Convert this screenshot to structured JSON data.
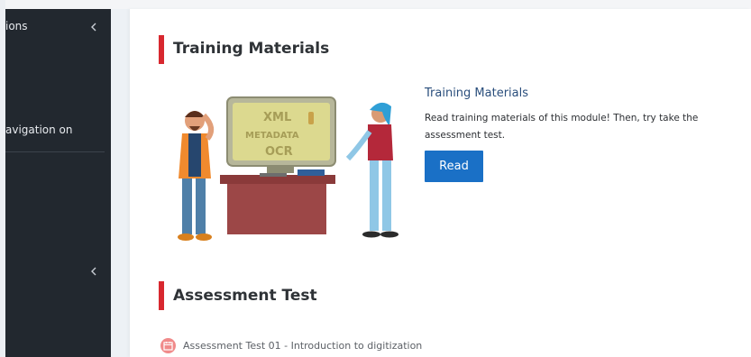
{
  "sidebar": {
    "items": [
      {
        "label": "ions"
      },
      {
        "label": "avigation on"
      }
    ]
  },
  "main": {
    "training": {
      "section_title": "Training Materials",
      "card_title": "Training Materials",
      "description": "Read training materials of this module! Then, try take the assessment test.",
      "read_label": "Read",
      "screen_words": [
        "XML",
        "METADATA",
        "OCR"
      ]
    },
    "assessment": {
      "section_title": "Assessment Test",
      "items": [
        {
          "label": "Assessment Test 01 - Introduction to digitization"
        }
      ]
    }
  },
  "colors": {
    "sidebar_bg": "#22282f",
    "accent_red": "#d8282f",
    "button_blue": "#1a70c6",
    "link_blue": "#2a4e7c",
    "test_icon_pink": "#f08a8a"
  },
  "icons": {
    "sidebar_collapse": "chevron-left-icon",
    "test_item": "calendar-icon"
  }
}
